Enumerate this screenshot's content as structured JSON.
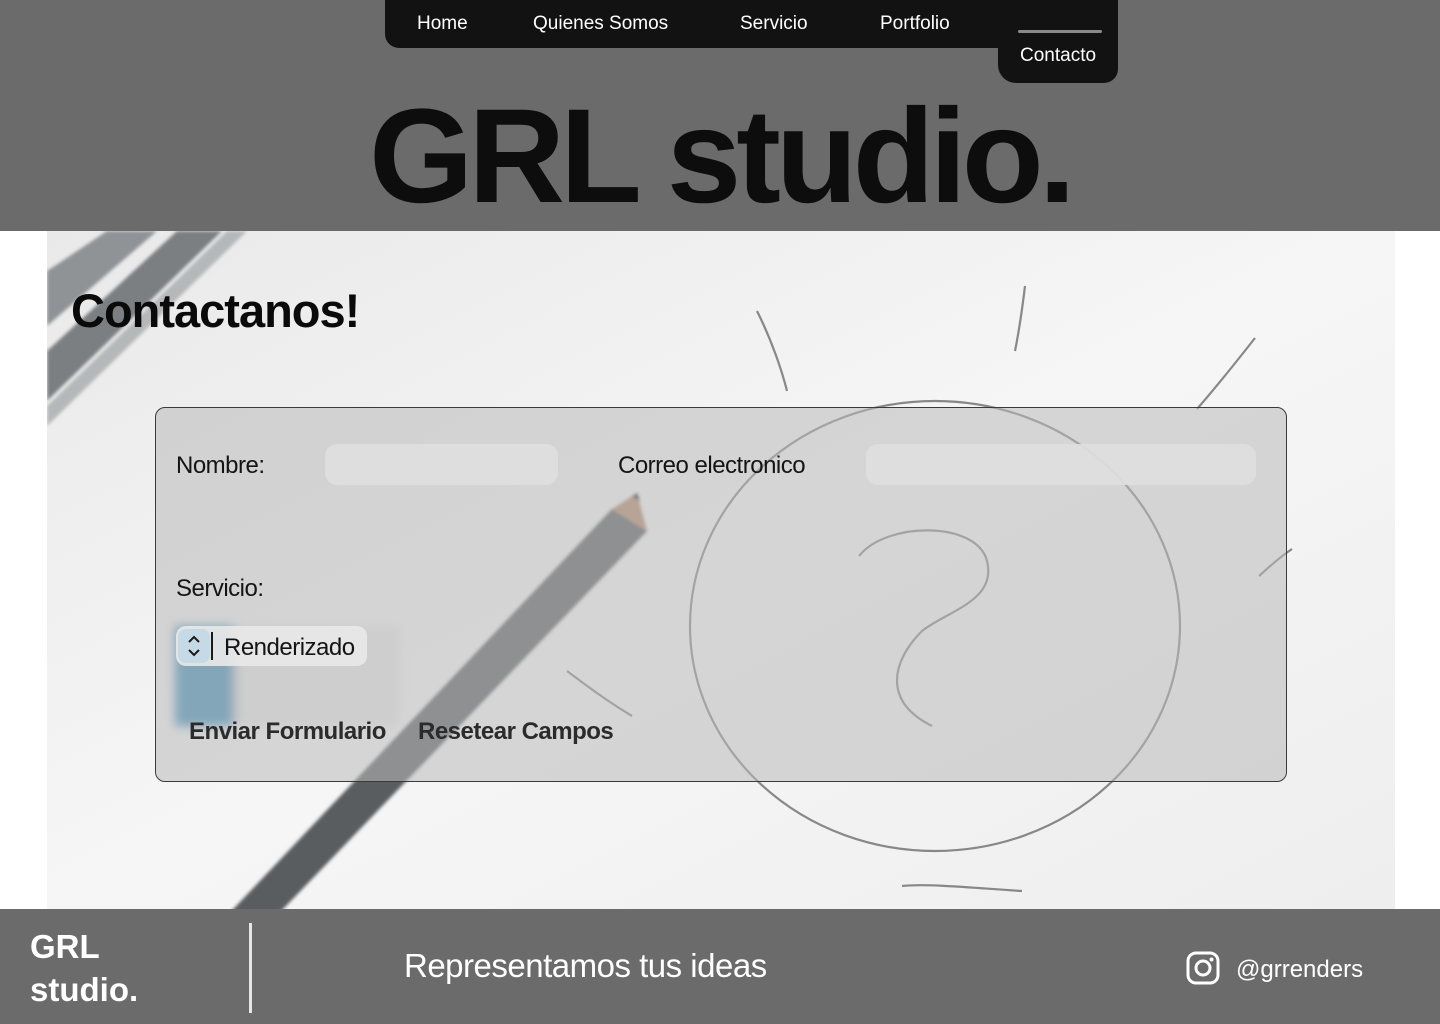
{
  "nav": {
    "items": [
      {
        "label": "Home"
      },
      {
        "label": "Quienes Somos"
      },
      {
        "label": "Servicio"
      },
      {
        "label": "Portfolio"
      }
    ],
    "active_label": "Contacto"
  },
  "header": {
    "brand": "GRL studio."
  },
  "contact": {
    "heading": "Contactanos!",
    "name_label": "Nombre:",
    "email_label": "Correo electronico",
    "service_label": "Servicio:",
    "service_selected": "Renderizado",
    "submit_label": "Enviar Formulario",
    "reset_label": "Resetear Campos"
  },
  "footer": {
    "brand": "GRL studio.",
    "tagline": "Representamos tus ideas",
    "instagram_handle": "@grrenders",
    "icon": "instagram-icon"
  },
  "colors": {
    "header_bg": "#6b6b6b",
    "nav_bg": "#121212",
    "panel_border": "#3a3a3a",
    "select_accent": "#c6d9e6"
  }
}
